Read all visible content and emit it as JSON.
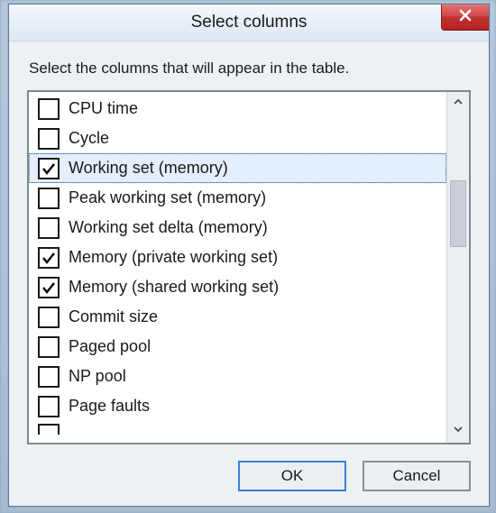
{
  "title": "Select columns",
  "instruction": "Select the columns that will appear in the table.",
  "columns": [
    {
      "label": "CPU time",
      "checked": false,
      "selected": false
    },
    {
      "label": "Cycle",
      "checked": false,
      "selected": false
    },
    {
      "label": "Working set (memory)",
      "checked": true,
      "selected": true
    },
    {
      "label": "Peak working set (memory)",
      "checked": false,
      "selected": false
    },
    {
      "label": "Working set delta (memory)",
      "checked": false,
      "selected": false
    },
    {
      "label": "Memory (private working set)",
      "checked": true,
      "selected": false
    },
    {
      "label": "Memory (shared working set)",
      "checked": true,
      "selected": false
    },
    {
      "label": "Commit size",
      "checked": false,
      "selected": false
    },
    {
      "label": "Paged pool",
      "checked": false,
      "selected": false
    },
    {
      "label": "NP pool",
      "checked": false,
      "selected": false
    },
    {
      "label": "Page faults",
      "checked": false,
      "selected": false
    }
  ],
  "buttons": {
    "ok": "OK",
    "cancel": "Cancel"
  }
}
